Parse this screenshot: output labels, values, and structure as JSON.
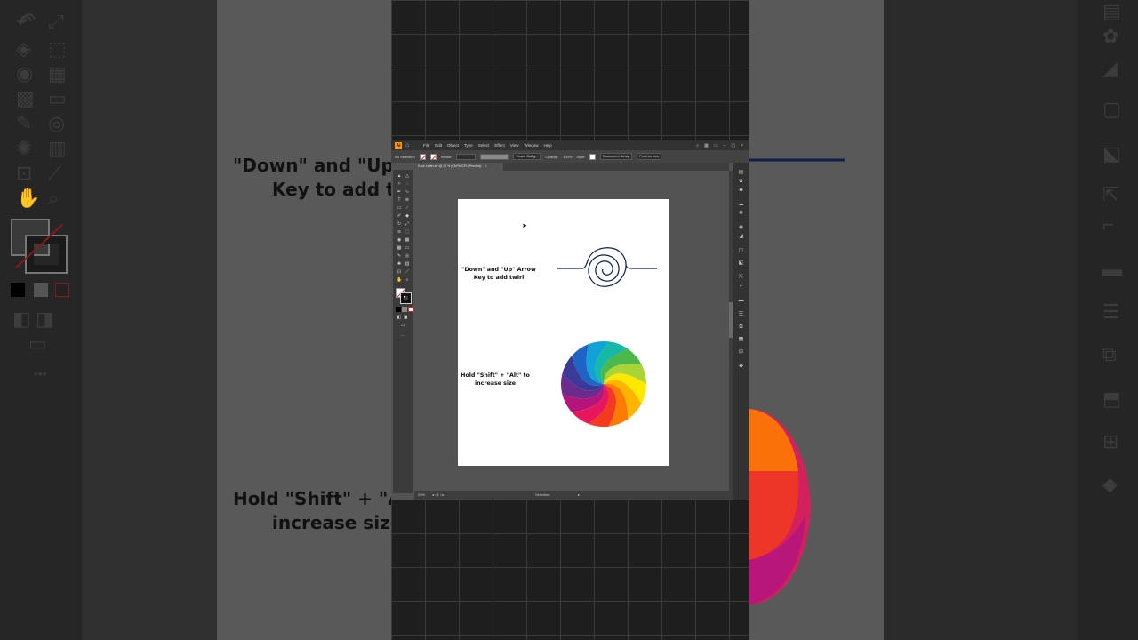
{
  "background": {
    "headline_1": "\"Down\" and \"Up\" Arrow Key to add twirl",
    "headline_1_visible_line1": "\"Down\" and \"Up",
    "headline_1_visible_line2": "Key to add tw",
    "headline_2_visible_line1": "Hold \"Shift\" + \"A",
    "headline_2_visible_line2": "increase size"
  },
  "window": {
    "menu": [
      "File",
      "Edit",
      "Object",
      "Type",
      "Select",
      "Effect",
      "View",
      "Window",
      "Help"
    ],
    "title_icons": [
      "search-icon",
      "arrange-icon",
      "panel-icon",
      "minimize-icon",
      "maximize-icon",
      "close-icon"
    ]
  },
  "control_bar": {
    "selection_label": "No Selection",
    "stroke_label": "Stroke:",
    "brush_label": "Touch Callig...",
    "opacity_label": "Opacity:",
    "opacity_value": "100%",
    "style_label": "Style:",
    "document_setup": "Document Setup",
    "preferences": "Preferences"
  },
  "document_tab": {
    "label": "Ease Letter.ai* @ 29 % (CMYK/CPU Preview)",
    "close": "×"
  },
  "artboard": {
    "instruction_1": "\"Down\" and \"Up\" Arrow Key to add twirl",
    "instruction_1_line1": "\"Down\" and \"Up\" Arrow",
    "instruction_1_line2": "Key to add twirl",
    "instruction_2": "Hold \"Shift\" + \"Alt\" to increase size",
    "instruction_2_line1": "Hold \"Shift\" + \"Alt\" to",
    "instruction_2_line2": "increase size"
  },
  "status_bar": {
    "zoom": "29%",
    "tool_name": "Selection"
  },
  "colors": {
    "spiral_stroke": "#0f1f4a",
    "rainbow": [
      "#ffe800",
      "#ffb400",
      "#ff7a00",
      "#f23a1e",
      "#e8175d",
      "#b5157b",
      "#6c2a8c",
      "#3a3b98",
      "#1f63c7",
      "#12a3d6",
      "#16b8a6",
      "#4cb84a",
      "#a9d437"
    ]
  }
}
